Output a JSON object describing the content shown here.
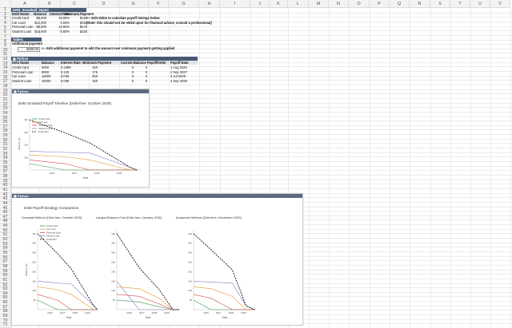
{
  "columns": [
    "A",
    "B",
    "C",
    "D",
    "E",
    "F",
    "G",
    "H",
    "I",
    "J",
    "K",
    "L",
    "M",
    "N",
    "O",
    "P",
    "Q",
    "R",
    "S",
    "T",
    "U",
    "V"
  ],
  "rows": [
    1,
    2,
    3,
    4,
    5,
    6,
    7,
    8,
    9,
    10,
    11,
    12,
    13,
    14,
    15,
    16,
    17,
    18,
    19,
    20,
    21,
    22,
    23,
    24,
    25,
    26,
    27,
    28,
    29,
    30,
    31,
    32,
    33,
    34,
    35,
    36,
    37,
    38,
    39,
    40,
    41,
    42,
    43,
    44,
    45,
    46,
    47,
    48,
    49,
    50,
    51,
    52,
    53,
    54,
    55,
    56,
    57,
    58,
    59,
    60,
    61,
    62,
    63,
    64,
    65,
    66,
    67,
    68,
    69,
    70,
    71
  ],
  "inputs": {
    "title": "Debt_Snowball_inputs",
    "headers": [
      "Debt Name",
      "Balance",
      "Interest Rate",
      "Minimum Payment"
    ],
    "rows": [
      [
        "Credit Card",
        "$5,000",
        "19.99%",
        "$150"
      ],
      [
        "Car Loan",
        "$12,000",
        "4.50%",
        "$250"
      ],
      [
        "Personal Loan",
        "$8,000",
        "12.50%",
        "$175"
      ],
      [
        "Student Loan",
        "$15,000",
        "5.80%",
        "$150"
      ]
    ],
    "note1": "<-- Edit debts to calculate payoff timings below",
    "note2": "(Note: this should not be relied upon for financial advice, consult a professional)"
  },
  "table1": {
    "title": "Table1",
    "label": "Additional payment",
    "value": "$200.00",
    "note": "<-- Edit additional payment to edit the amount over minimum payment getting applied"
  },
  "python_table": {
    "title": "Python",
    "headers": [
      "Debt Name",
      "Balance",
      "Interest Rate",
      "Minimum Payment",
      "Current Balance",
      "PayoffOrder",
      "Payoff Date"
    ],
    "rows": [
      [
        "Credit Card",
        "5000",
        "0.1999",
        "150",
        "0",
        "1 Aug 2026"
      ],
      [
        "Personal Loan",
        "8000",
        "0.125",
        "175",
        "0",
        "2 Sep 2027"
      ],
      [
        "Car Loan",
        "12000",
        "0.045",
        "250",
        "0",
        "3 Jul 2029"
      ],
      [
        "Student Loan",
        "15000",
        "0.058",
        "150",
        "0",
        "4 Sep 2029"
      ]
    ],
    "extra_col": [
      "0",
      "0",
      "0",
      "0"
    ]
  },
  "chart1": {
    "panel_title": "Python",
    "chart_data": {
      "type": "line",
      "title": "Debt Snowball Payoff Timeline (Debt-free: October 2029)",
      "xlabel": "Date",
      "ylabel": "Balance ($)",
      "x": [
        2025.0,
        2026.6,
        2027.7,
        2029.5,
        2029.8
      ],
      "xticks": [
        "2026",
        "2027",
        "2028",
        "2029"
      ],
      "yticks": [
        "10k",
        "20k",
        "30k",
        "40k"
      ],
      "ylim": [
        0,
        42000
      ],
      "legend": "top-left",
      "series": [
        {
          "name": "Credit Card",
          "color": "#3a9a4a",
          "values": [
            5000,
            0,
            0,
            0,
            0
          ]
        },
        {
          "name": "Car Loan",
          "color": "#e3962e",
          "values": [
            12000,
            10500,
            8000,
            0,
            0
          ]
        },
        {
          "name": "Personal Loan",
          "color": "#d64747",
          "values": [
            8000,
            5000,
            0,
            0,
            0
          ]
        },
        {
          "name": "Student Loan",
          "color": "#8a7dc4",
          "values": [
            15000,
            14000,
            13500,
            2000,
            0
          ]
        },
        {
          "name": "Total Debt",
          "color": "#111111",
          "dashed": true,
          "values": [
            40000,
            29500,
            21500,
            2000,
            0
          ]
        }
      ]
    }
  },
  "chart2": {
    "panel_title": "Python",
    "main_title": "Debt Payoff Strategy Comparison",
    "charts": [
      {
        "title": "Snowball Method (Debt-free: October 2029)"
      },
      {
        "title": "Largest Balance First (Debt-free: January 2030)"
      },
      {
        "title": "Avalanche Method (Debt-free: November 2029)"
      }
    ],
    "xlabel": "Date",
    "ylabel": "Balance ($)",
    "xticks": [
      "2026",
      "2027",
      "2028",
      "2029"
    ],
    "yticks": [
      "5k",
      "10k",
      "15k",
      "20k",
      "25k",
      "30k",
      "35k",
      "40k"
    ],
    "legend": [
      "Credit Card",
      "Car Loan",
      "Personal Loan",
      "Student Loan",
      "Total Debt"
    ],
    "chart_data": [
      {
        "type": "line",
        "title": "Snowball Method (Debt-free: October 2029)",
        "x": [
          2025.0,
          2026.6,
          2027.7,
          2029.5,
          2029.8
        ],
        "ylim": [
          0,
          42000
        ],
        "series": [
          {
            "name": "Credit Card",
            "values": [
              5000,
              0,
              0,
              0,
              0
            ]
          },
          {
            "name": "Car Loan",
            "values": [
              12000,
              10500,
              8000,
              0,
              0
            ]
          },
          {
            "name": "Personal Loan",
            "values": [
              8000,
              5000,
              0,
              0,
              0
            ]
          },
          {
            "name": "Student Loan",
            "values": [
              15000,
              14000,
              13500,
              2000,
              0
            ]
          },
          {
            "name": "Total Debt",
            "values": [
              40000,
              29500,
              21500,
              2000,
              0
            ]
          }
        ]
      },
      {
        "type": "line",
        "title": "Largest Balance First (Debt-free: January 2030)",
        "x": [
          2025.0,
          2026.8,
          2028.4,
          2029.5,
          2030.0
        ],
        "ylim": [
          0,
          42000
        ],
        "series": [
          {
            "name": "Credit Card",
            "values": [
              5000,
              4000,
              1500,
              0,
              0
            ]
          },
          {
            "name": "Car Loan",
            "values": [
              12000,
              11000,
              6000,
              0,
              0
            ]
          },
          {
            "name": "Personal Loan",
            "values": [
              8000,
              7000,
              3000,
              0,
              0
            ]
          },
          {
            "name": "Student Loan",
            "values": [
              15000,
              0,
              0,
              0,
              0
            ]
          },
          {
            "name": "Total Debt",
            "values": [
              40000,
              22000,
              10500,
              0,
              0
            ]
          }
        ]
      },
      {
        "type": "line",
        "title": "Avalanche Method (Debt-free: November 2029)",
        "x": [
          2025.0,
          2026.4,
          2028.1,
          2029.2,
          2029.9
        ],
        "ylim": [
          0,
          42000
        ],
        "series": [
          {
            "name": "Credit Card",
            "values": [
              5000,
              0,
              0,
              0,
              0
            ]
          },
          {
            "name": "Car Loan",
            "values": [
              12000,
              11000,
              7000,
              0,
              0
            ]
          },
          {
            "name": "Personal Loan",
            "values": [
              8000,
              6000,
              0,
              0,
              0
            ]
          },
          {
            "name": "Student Loan",
            "values": [
              15000,
              14500,
              14000,
              2000,
              0
            ]
          },
          {
            "name": "Total Debt",
            "values": [
              40000,
              31500,
              21000,
              2000,
              0
            ]
          }
        ]
      }
    ]
  },
  "colors": {
    "header_bar": "#465b74",
    "panel_bar": "#5a6b82",
    "series": [
      "#3a9a4a",
      "#e3962e",
      "#d64747",
      "#8a7dc4",
      "#111111"
    ]
  }
}
